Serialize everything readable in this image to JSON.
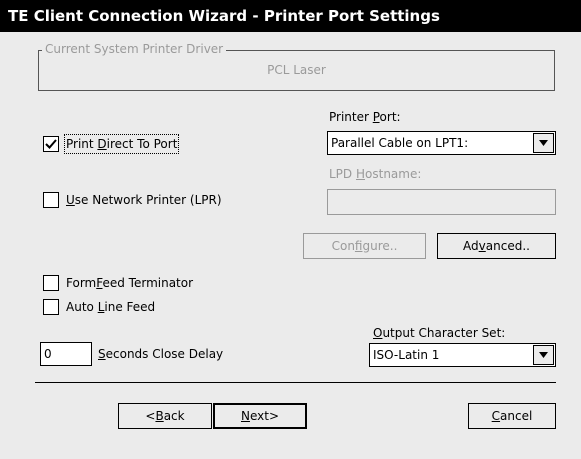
{
  "window": {
    "title": "TE Client Connection Wizard - Printer Port Settings"
  },
  "driver_group": {
    "legend": "Current System Printer Driver",
    "value": "PCL Laser"
  },
  "print_direct": {
    "label_pre": "Print ",
    "label_mnemonic": "D",
    "label_post": "irect To Port",
    "checked": true
  },
  "network_printer": {
    "label_pre": "",
    "label_mnemonic": "U",
    "label_post": "se Network Printer (LPR)",
    "checked": false
  },
  "printer_port": {
    "label_pre": "Printer ",
    "label_mnemonic": "P",
    "label_post": "ort:",
    "selected": "Parallel Cable on LPT1:"
  },
  "lpd_hostname": {
    "label_pre": "LPD ",
    "label_mnemonic": "H",
    "label_post": "ostname:",
    "value": ""
  },
  "configure_button": {
    "label_pre": "Con",
    "label_mnemonic": "f",
    "label_post": "igure.."
  },
  "advanced_button": {
    "label_pre": "Ad",
    "label_mnemonic": "v",
    "label_post": "anced.."
  },
  "formfeed": {
    "label_pre": "Form",
    "label_mnemonic": "F",
    "label_post": "eed Terminator",
    "checked": false
  },
  "auto_line_feed": {
    "label_pre": "Auto ",
    "label_mnemonic": "L",
    "label_post": "ine Feed",
    "checked": false
  },
  "close_delay": {
    "value": "0",
    "label_pre": "",
    "label_mnemonic": "S",
    "label_post": "econds Close Delay"
  },
  "charset": {
    "label_pre": "",
    "label_mnemonic": "O",
    "label_post": "utput Character Set:",
    "selected": "ISO-Latin 1"
  },
  "nav": {
    "back_pre": "<",
    "back_mnemonic": "B",
    "back_post": "ack",
    "next_pre": "",
    "next_mnemonic": "N",
    "next_post": "ext>",
    "cancel_pre": "",
    "cancel_mnemonic": "C",
    "cancel_post": "ancel"
  },
  "icons": {
    "checkmark": "checkmark-icon",
    "dropdown": "chevron-down-icon"
  }
}
